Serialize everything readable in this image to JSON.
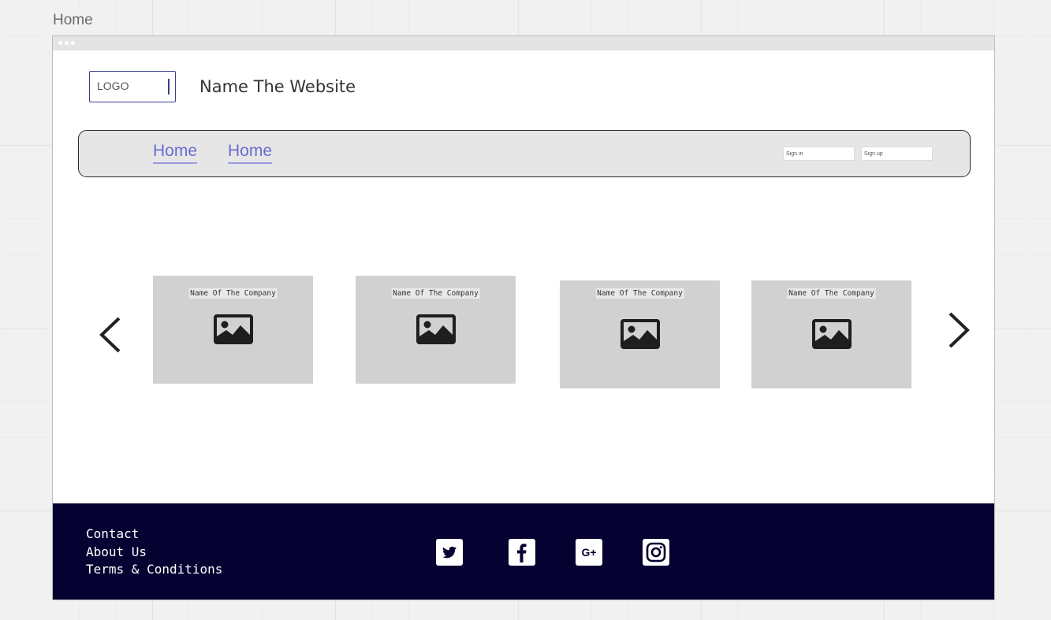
{
  "canvas": {
    "page_label": "Home"
  },
  "header": {
    "logo_text": "LOGO",
    "site_name": "Name The Website"
  },
  "navbar": {
    "links": [
      {
        "label": "Home"
      },
      {
        "label": "Home"
      }
    ],
    "sign_in_placeholder": "Sign in",
    "sign_up_placeholder": "Sign up"
  },
  "carousel": {
    "prev_icon": "chevron-left-icon",
    "next_icon": "chevron-right-icon",
    "cards": [
      {
        "title": "Name Of The Company",
        "icon": "image-icon"
      },
      {
        "title": "Name Of The Company",
        "icon": "image-icon"
      },
      {
        "title": "Name Of The Company",
        "icon": "image-icon"
      },
      {
        "title": "Name Of The Company",
        "icon": "image-icon"
      }
    ]
  },
  "footer": {
    "links": [
      {
        "label": "Contact"
      },
      {
        "label": "About Us"
      },
      {
        "label": "Terms & Conditions"
      }
    ],
    "social": [
      {
        "icon": "twitter-icon"
      },
      {
        "icon": "facebook-icon"
      },
      {
        "icon": "google-plus-icon",
        "text": "G+"
      },
      {
        "icon": "instagram-icon"
      }
    ]
  },
  "colors": {
    "footer_bg": "#050130",
    "nav_link": "#6a6ccf",
    "logo_border": "#3a3f8f",
    "navbar_bg": "#e6e6e6",
    "card_bg": "#d1d1d1"
  }
}
